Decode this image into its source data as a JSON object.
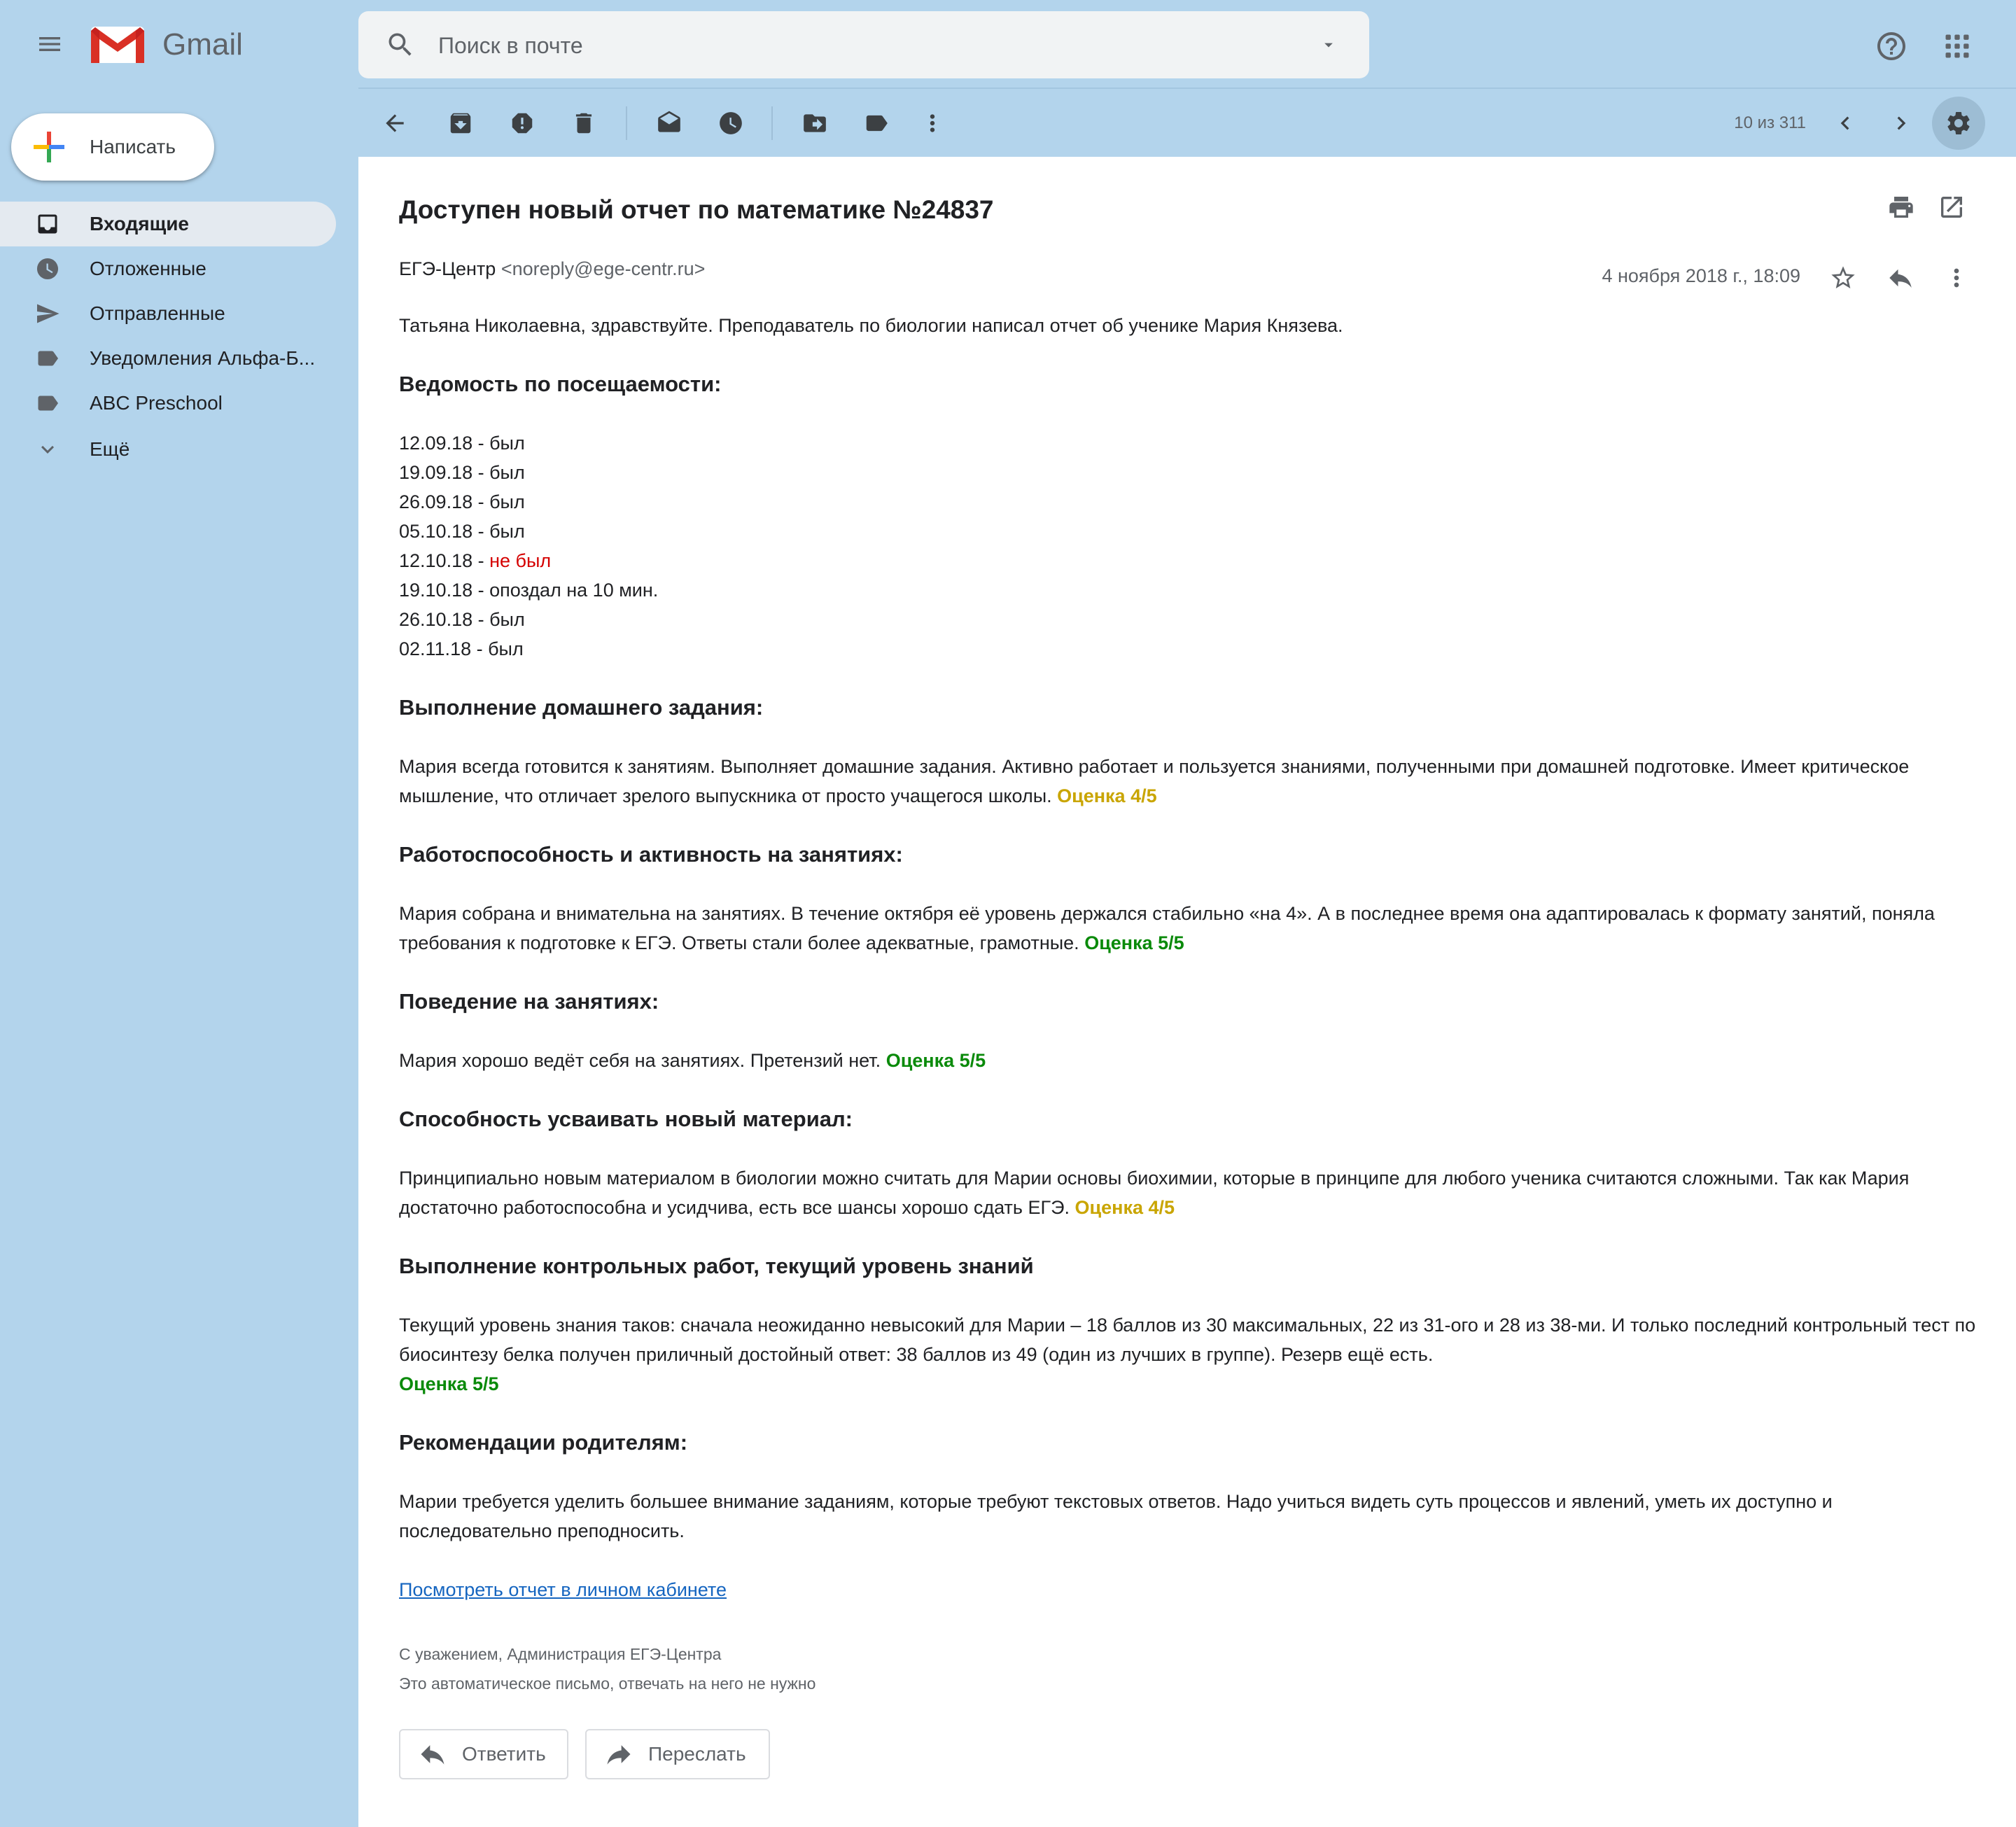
{
  "app": {
    "name": "Gmail"
  },
  "search": {
    "placeholder": "Поиск в почте"
  },
  "compose": {
    "label": "Написать"
  },
  "sidebar": {
    "items": [
      {
        "label": "Входящие",
        "icon": "inbox-icon",
        "active": true
      },
      {
        "label": "Отложенные",
        "icon": "clock-icon",
        "active": false
      },
      {
        "label": "Отправленные",
        "icon": "send-icon",
        "active": false
      },
      {
        "label": "Уведомления Альфа-Б...",
        "icon": "label-icon",
        "active": false
      },
      {
        "label": "ABC Preschool",
        "icon": "label-icon",
        "active": false
      },
      {
        "label": "Ещё",
        "icon": "chevron-down-icon",
        "active": false
      }
    ]
  },
  "toolbar": {
    "pager": "10 из 311",
    "icons": [
      "back-arrow-icon",
      "archive-icon",
      "report-spam-icon",
      "delete-icon",
      "mark-unread-icon",
      "snooze-icon",
      "move-to-icon",
      "label-icon",
      "more-vert-icon",
      "chevron-left-icon",
      "chevron-right-icon",
      "settings-icon"
    ]
  },
  "email": {
    "subject": "Доступен новый отчет по математике №24837",
    "sender_name": "ЕГЭ-Центр",
    "sender_email": "<noreply@ege-centr.ru>",
    "date": "4 ноября 2018 г., 18:09",
    "greeting": "Татьяна Николаевна, здравствуйте. Преподаватель по биологии написал отчет об ученике Мария Князева.",
    "attendance": {
      "heading": "Ведомость по посещаемости:",
      "rows": [
        {
          "date": "12.09.18 - ",
          "status": "был",
          "absent": false
        },
        {
          "date": "19.09.18 - ",
          "status": "был",
          "absent": false
        },
        {
          "date": "26.09.18 - ",
          "status": "был",
          "absent": false
        },
        {
          "date": "05.10.18 - ",
          "status": "был",
          "absent": false
        },
        {
          "date": "12.10.18 - ",
          "status": "не был",
          "absent": true
        },
        {
          "date": "19.10.18 - ",
          "status": "опоздал на 10 мин.",
          "absent": false
        },
        {
          "date": "26.10.18 - ",
          "status": "был",
          "absent": false
        },
        {
          "date": "02.11.18 - ",
          "status": "был",
          "absent": false
        }
      ]
    },
    "sections": [
      {
        "heading": "Выполнение домашнего задания:",
        "text": "Мария всегда готовится к занятиям. Выполняет домашние задания. Активно работает и пользуется знаниями, полученными при домашней подготовке. Имеет критическое мышление, что отличает зрелого выпускника от просто учащегося школы.",
        "grade": "Оценка 4/5",
        "grade_color": "#c9a500"
      },
      {
        "heading": "Работоспособность и активность на занятиях:",
        "text": "Мария собрана и внимательна на занятиях. В течение октября её уровень держался стабильно «на 4». А в последнее время она адаптировалась к формату занятий, поняла требования к подготовке к ЕГЭ. Ответы стали более адекватные, грамотные.",
        "grade": "Оценка 5/5",
        "grade_color": "#0a8a0a"
      },
      {
        "heading": "Поведение на занятиях:",
        "text": "Мария хорошо ведёт себя на занятиях. Претензий нет.",
        "grade": "Оценка 5/5",
        "grade_color": "#0a8a0a"
      },
      {
        "heading": "Способность усваивать новый материал:",
        "text": "Принципиально новым материалом в биологии можно считать для Марии основы биохимии, которые в принципе для любого ученика считаются сложными. Так как Мария достаточно работоспособна и усидчива, есть все шансы хорошо сдать ЕГЭ.",
        "grade": "Оценка 4/5",
        "grade_color": "#c9a500"
      },
      {
        "heading": "Выполнение контрольных работ, текущий уровень знаний",
        "text": "Текущий уровень знания таков: сначала неожиданно невысокий для Марии – 18 баллов из 30 максимальных, 22 из 31-ого и 28 из 38-ми. И только последний контрольный тест по биосинтезу белка получен приличный достойный ответ: 38 баллов из 49 (один из лучших в группе). Резерв ещё есть.",
        "grade": "Оценка 5/5",
        "grade_color": "#0a8a0a"
      },
      {
        "heading": "Рекомендации родителям:",
        "text": "Марии требуется уделить большее внимание заданиям, которые требуют текстовых ответов. Надо учиться видеть суть процессов и явлений, уметь их доступно и последовательно преподносить.",
        "grade": "",
        "grade_color": ""
      }
    ],
    "link": "Посмотреть отчет в личном кабинете",
    "signature_line1": "С уважением, Администрация ЕГЭ-Центра",
    "signature_line2": "Это автоматическое письмо, отвечать на него не нужно",
    "reply_label": "Ответить",
    "forward_label": "Переслать"
  },
  "colors": {
    "background": "#b3d4ec",
    "absent": "#d50000",
    "grade_good": "#0a8a0a",
    "grade_ok": "#c9a500",
    "link": "#1565c0"
  }
}
